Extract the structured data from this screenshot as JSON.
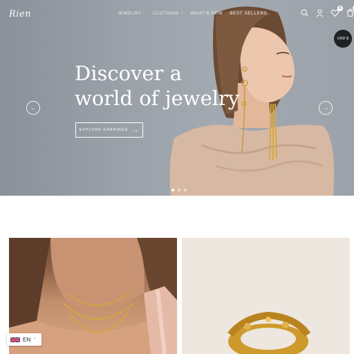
{
  "header": {
    "logo": "Rien",
    "nav": [
      {
        "label": "Jewelry",
        "has_dropdown": true
      },
      {
        "label": "Clothing",
        "has_dropdown": true
      },
      {
        "label": "What's New",
        "has_dropdown": false
      },
      {
        "label": "Best Sellers",
        "has_dropdown": false
      }
    ],
    "icons": [
      "search-icon",
      "account-icon",
      "wishlist-icon",
      "cart-icon"
    ],
    "wishlist_count": "0",
    "cart_count": "0"
  },
  "currency": "USD $",
  "hero": {
    "headline_line1": "Discover a",
    "headline_line2": "world of jewelry",
    "cta_label": "Explore earrings",
    "prev_icon": "arrow-left-icon",
    "next_icon": "arrow-right-icon",
    "slides_total": 3,
    "active_slide": 1
  },
  "language": {
    "code": "EN",
    "flag": "uk-flag-icon"
  },
  "colors": {
    "hero_bg": "#9aa1a9",
    "currency_bg": "#1f2124",
    "gold": "#c9962e"
  }
}
